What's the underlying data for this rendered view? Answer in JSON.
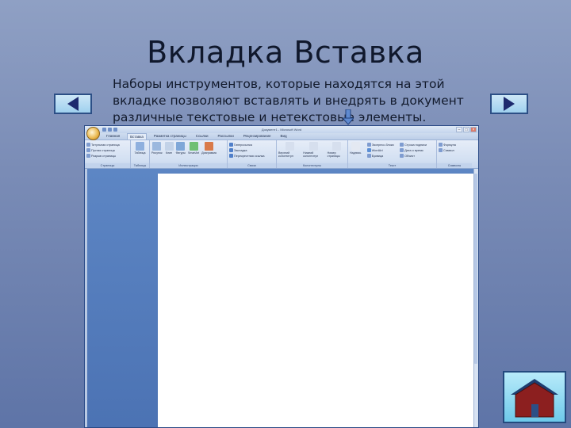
{
  "slide": {
    "title": "Вкладка Вставка",
    "text": "Наборы инструментов, которые находятся на этой вкладке позволяют  вставлять и внедрять в документ различные текстовые и нетекстовые элементы."
  },
  "colors": {
    "background_top": "#8fa0c4",
    "background_bottom": "#5e74a7",
    "nav_button": "#9fd0ee",
    "nav_arrow": "#1d2a6e",
    "word_workspace": "#4d77b8"
  },
  "navigation": {
    "prev_icon": "arrow-left-icon",
    "next_icon": "arrow-right-icon",
    "home_icon": "home-icon",
    "pointer_icon": "arrow-down-icon"
  },
  "word": {
    "window_title": "Документ1 - Microsoft Word",
    "tabs": [
      "Главная",
      "Вставка",
      "Разметка страницы",
      "Ссылки",
      "Рассылки",
      "Рецензирование",
      "Вид"
    ],
    "groups": {
      "pages": {
        "label": "Страницы",
        "items": [
          "Титульная страница",
          "Пустая страница",
          "Разрыв страницы"
        ]
      },
      "tables": {
        "label": "Таблицы",
        "item": "Таблица"
      },
      "illustrations": {
        "label": "Иллюстрации",
        "items": [
          "Рисунок",
          "Клип",
          "Фигуры",
          "SmartArt",
          "Диаграмма"
        ]
      },
      "links": {
        "label": "Связи",
        "items": [
          "Гиперссылка",
          "Закладка",
          "Перекрестная ссылка"
        ]
      },
      "header_footer": {
        "label": "Колонтитулы",
        "items": [
          "Верхний колонтитул",
          "Нижний колонтитул",
          "Номер страницы"
        ]
      },
      "text": {
        "label": "Текст",
        "items": [
          "Надпись",
          "Экспресс-блоки",
          "WordArt",
          "Буквица",
          "Строка подписи",
          "Дата и время",
          "Объект"
        ]
      },
      "symbols": {
        "label": "Символы",
        "items": [
          "Формула",
          "Символ"
        ]
      }
    }
  }
}
